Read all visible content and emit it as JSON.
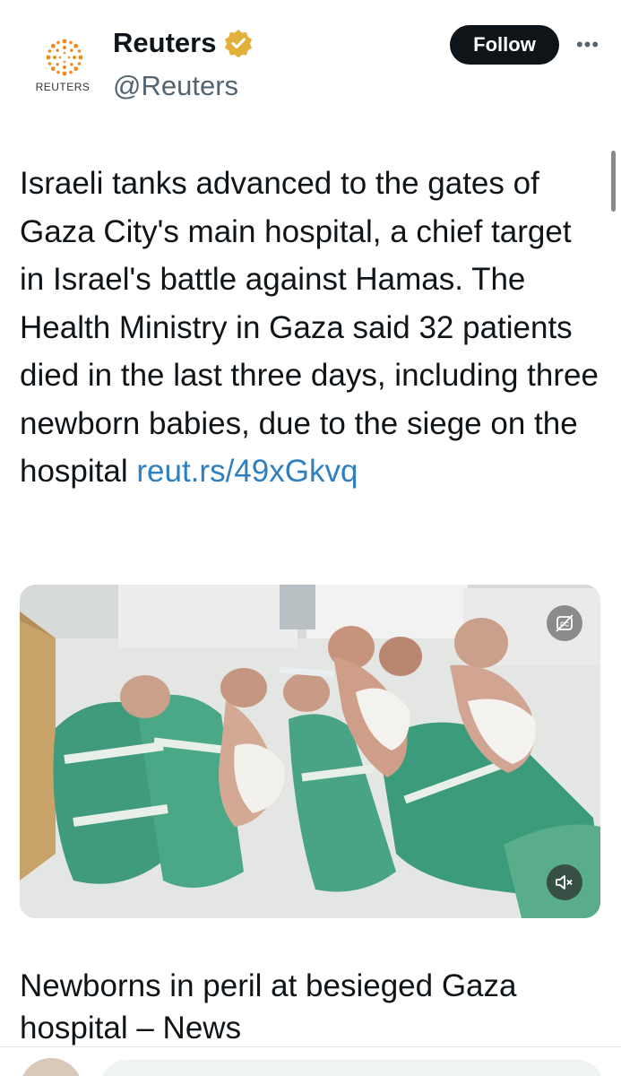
{
  "header": {
    "display_name": "Reuters",
    "handle": "@Reuters",
    "avatar_wordmark": "REUTERS",
    "follow_label": "Follow",
    "more_label": "•••"
  },
  "tweet": {
    "text": "Israeli tanks advanced to the gates of Gaza City's main hospital, a chief target in Israel's battle against Hamas. The Health Ministry in Gaza said 32 patients died in the last three days, including three newborn babies, due to the siege on the hospital",
    "link": "reut.rs/49xGkvq"
  },
  "media": {
    "title": "Newborns in peril at besieged Gaza hospital – News"
  },
  "colors": {
    "link": "#2f7fc1",
    "verified": "#e2b13c",
    "follow_bg": "#0f1419"
  }
}
